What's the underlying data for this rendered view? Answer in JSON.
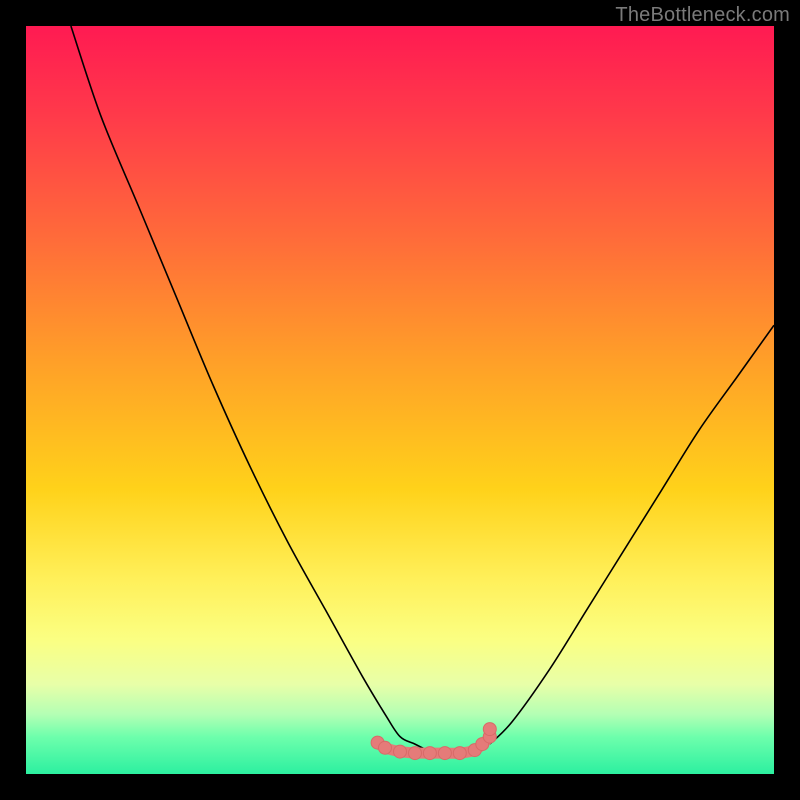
{
  "watermark": "TheBottleneck.com",
  "colors": {
    "frame": "#000000",
    "curve": "#000000",
    "marker_fill": "#e57b79",
    "marker_stroke": "#d86a68"
  },
  "chart_data": {
    "type": "line",
    "title": "",
    "xlabel": "",
    "ylabel": "",
    "xlim": [
      0,
      100
    ],
    "ylim": [
      0,
      100
    ],
    "grid": false,
    "legend": false,
    "series": [
      {
        "name": "left-arm",
        "x": [
          6,
          10,
          15,
          20,
          25,
          30,
          35,
          40,
          45,
          48,
          50,
          52,
          54
        ],
        "y": [
          100,
          88,
          76,
          64,
          52,
          41,
          31,
          22,
          13,
          8,
          5,
          4,
          3
        ]
      },
      {
        "name": "right-arm",
        "x": [
          62,
          65,
          70,
          75,
          80,
          85,
          90,
          95,
          100
        ],
        "y": [
          4,
          7,
          14,
          22,
          30,
          38,
          46,
          53,
          60
        ]
      },
      {
        "name": "bottom-markers",
        "x": [
          47,
          48,
          50,
          52,
          54,
          56,
          58,
          60,
          61,
          62,
          62
        ],
        "y": [
          4.2,
          3.5,
          3.0,
          2.8,
          2.8,
          2.8,
          2.8,
          3.2,
          4.0,
          5.0,
          6.0
        ]
      }
    ]
  }
}
